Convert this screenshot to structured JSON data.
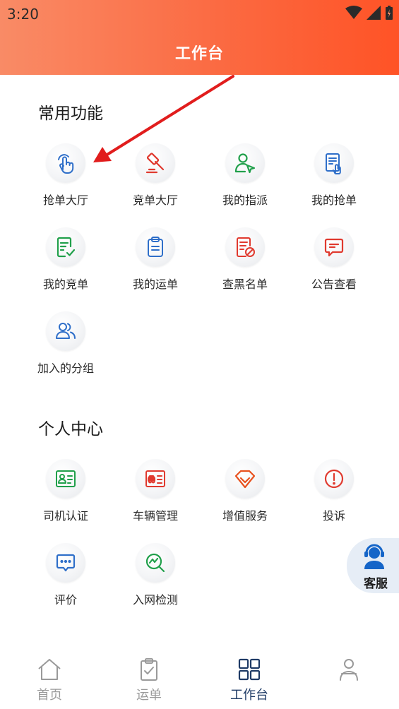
{
  "status_bar": {
    "time": "3:20"
  },
  "header": {
    "title": "工作台"
  },
  "common": {
    "title": "常用功能",
    "items": [
      {
        "label": "抢单大厅",
        "icon": "tap-hand-icon"
      },
      {
        "label": "竞单大厅",
        "icon": "auction-hammer-icon"
      },
      {
        "label": "我的指派",
        "icon": "user-assign-icon"
      },
      {
        "label": "我的抢单",
        "icon": "document-tap-icon"
      },
      {
        "label": "我的竞单",
        "icon": "document-check-icon"
      },
      {
        "label": "我的运单",
        "icon": "clipboard-icon"
      },
      {
        "label": "查黑名单",
        "icon": "blacklist-icon"
      },
      {
        "label": "公告查看",
        "icon": "announcement-icon"
      },
      {
        "label": "加入的分组",
        "icon": "group-icon"
      }
    ]
  },
  "personal": {
    "title": "个人中心",
    "items": [
      {
        "label": "司机认证",
        "icon": "id-card-icon"
      },
      {
        "label": "车辆管理",
        "icon": "vehicle-card-icon"
      },
      {
        "label": "增值服务",
        "icon": "diamond-icon"
      },
      {
        "label": "投诉",
        "icon": "alert-icon"
      },
      {
        "label": "评价",
        "icon": "comment-icon"
      },
      {
        "label": "入网检测",
        "icon": "search-chart-icon"
      }
    ]
  },
  "customer_service": {
    "label": "客服",
    "icon": "headset-agent-icon"
  },
  "tabbar": {
    "items": [
      {
        "label": "首页",
        "icon": "home-icon"
      },
      {
        "label": "运单",
        "icon": "clipboard-check-icon"
      },
      {
        "label": "工作台",
        "icon": "grid-icon",
        "active": true
      },
      {
        "label": "",
        "icon": "profile-icon"
      }
    ]
  },
  "colors": {
    "header_start": "#f98b66",
    "header_end": "#ff5326",
    "icon_blue": "#2f6fc9",
    "icon_red": "#e03a2f",
    "icon_green": "#21a04b",
    "tab_active": "#1f3b66",
    "tab_inactive": "#9a9a9a",
    "arrow": "#e11d1d"
  }
}
